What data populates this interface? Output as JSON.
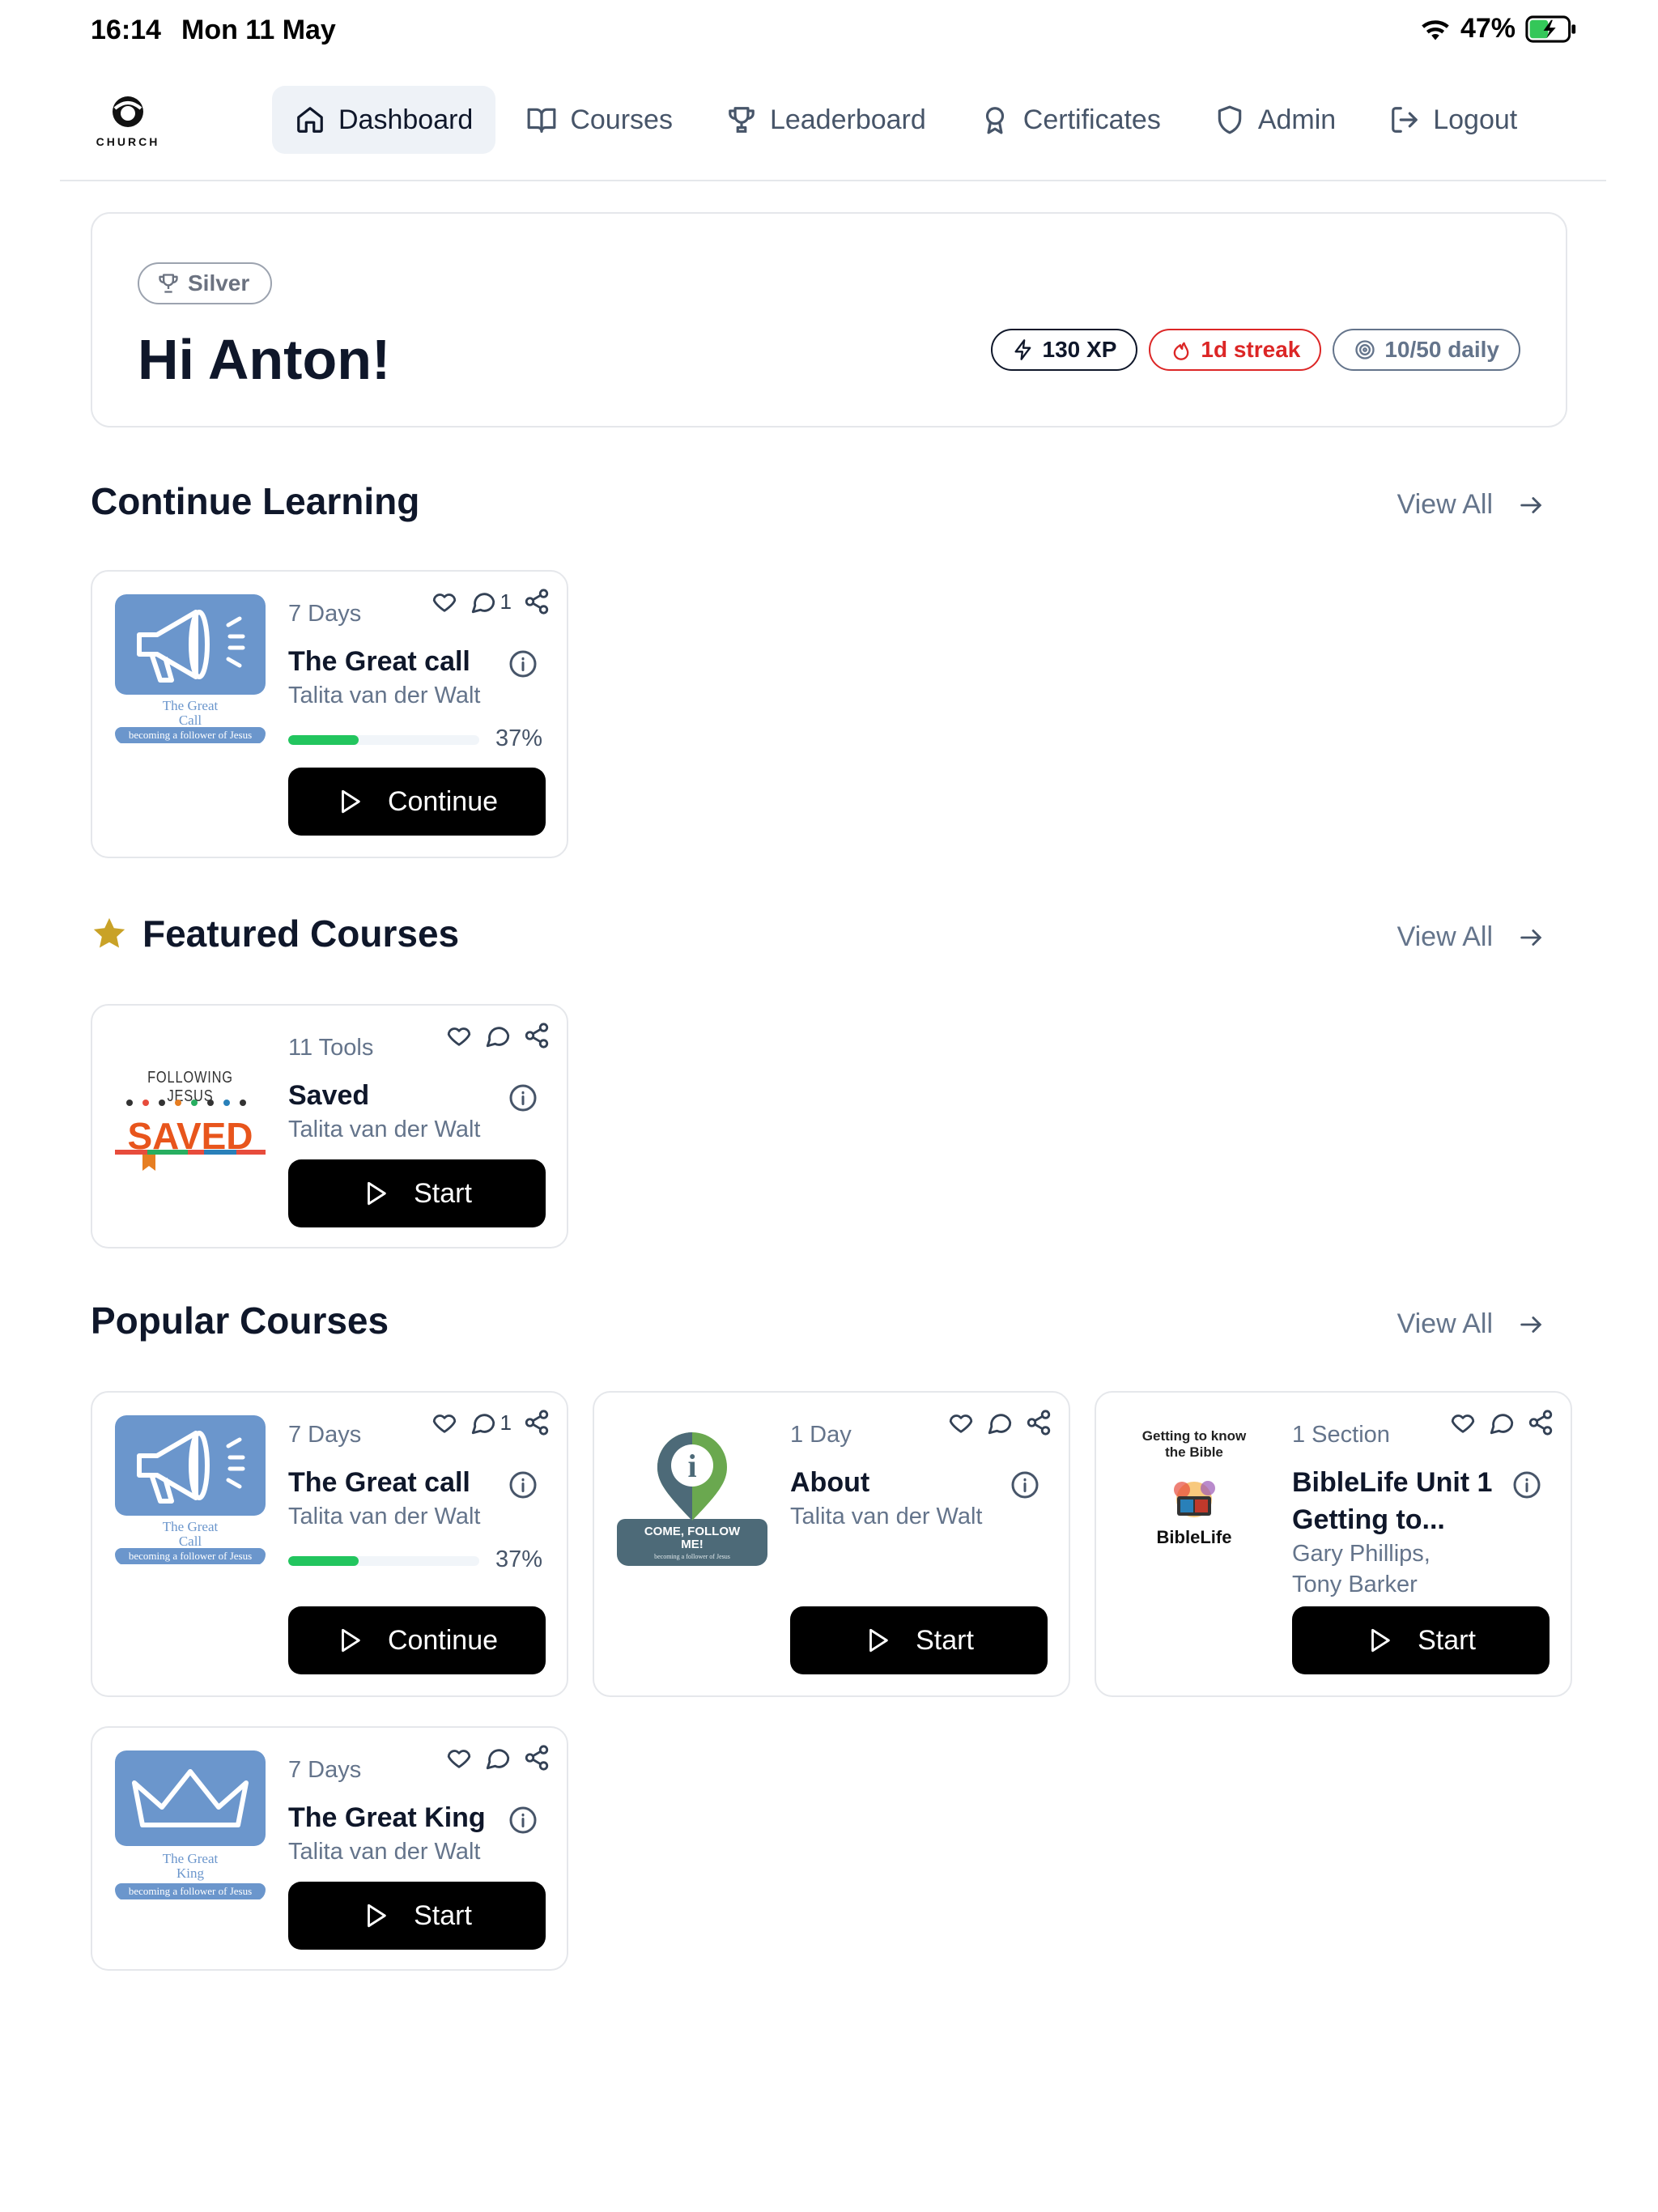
{
  "status_bar": {
    "time": "16:14",
    "date": "Mon 11 May",
    "battery": "47%"
  },
  "nav": {
    "logo_text": "CHURCH",
    "items": [
      {
        "label": "Dashboard",
        "icon": "home-icon",
        "active": true
      },
      {
        "label": "Courses",
        "icon": "book-icon"
      },
      {
        "label": "Leaderboard",
        "icon": "trophy-icon"
      },
      {
        "label": "Certificates",
        "icon": "award-icon"
      },
      {
        "label": "Admin",
        "icon": "shield-icon"
      },
      {
        "label": "Logout",
        "icon": "logout-icon"
      }
    ]
  },
  "hero": {
    "tier": "Silver",
    "greeting": "Hi Anton!",
    "xp": "130 XP",
    "streak": "1d streak",
    "daily": "10/50 daily"
  },
  "sections": {
    "continue": {
      "title": "Continue Learning",
      "view_all": "View All"
    },
    "featured": {
      "title": "Featured Courses",
      "view_all": "View All"
    },
    "popular": {
      "title": "Popular Courses",
      "view_all": "View All"
    }
  },
  "cards": {
    "continue_1": {
      "meta": "7 Days",
      "comments": "1",
      "title": "The Great call",
      "author": "Talita van der Walt",
      "progress": 37,
      "progress_label": "37%",
      "button": "Continue",
      "thumb_line1": "The Great",
      "thumb_line2": "Call",
      "thumb_footer": "becoming a follower of Jesus"
    },
    "featured_1": {
      "meta": "11 Tools",
      "title": "Saved",
      "author": "Talita van der Walt",
      "button": "Start",
      "thumb_top": "FOLLOWING JESUS",
      "thumb_main": "SAVED"
    },
    "popular_1": {
      "meta": "7 Days",
      "comments": "1",
      "title": "The Great call",
      "author": "Talita van der Walt",
      "progress": 37,
      "progress_label": "37%",
      "button": "Continue",
      "thumb_line1": "The Great",
      "thumb_line2": "Call",
      "thumb_footer": "becoming a follower of Jesus"
    },
    "popular_2": {
      "meta": "1 Day",
      "title": "About",
      "author": "Talita van der Walt",
      "button": "Start",
      "thumb_main": "COME, FOLLOW ME!",
      "thumb_footer": "becoming a follower of Jesus"
    },
    "popular_3": {
      "meta": "1 Section",
      "title": "BibleLife Unit 1 Getting to...",
      "author": "Gary Phillips, Tony Barker",
      "button": "Start",
      "thumb_top": "Getting to know the Bible",
      "thumb_main": "BibleLife"
    },
    "popular_4": {
      "meta": "7 Days",
      "title": "The Great King",
      "author": "Talita van der Walt",
      "button": "Start",
      "thumb_line1": "The Great",
      "thumb_line2": "King",
      "thumb_footer": "becoming a follower of Jesus"
    }
  },
  "colors": {
    "accent_green": "#22c55e",
    "streak_red": "#dc2626",
    "star_gold": "#c9a227",
    "thumb_blue": "#6b96cc"
  }
}
